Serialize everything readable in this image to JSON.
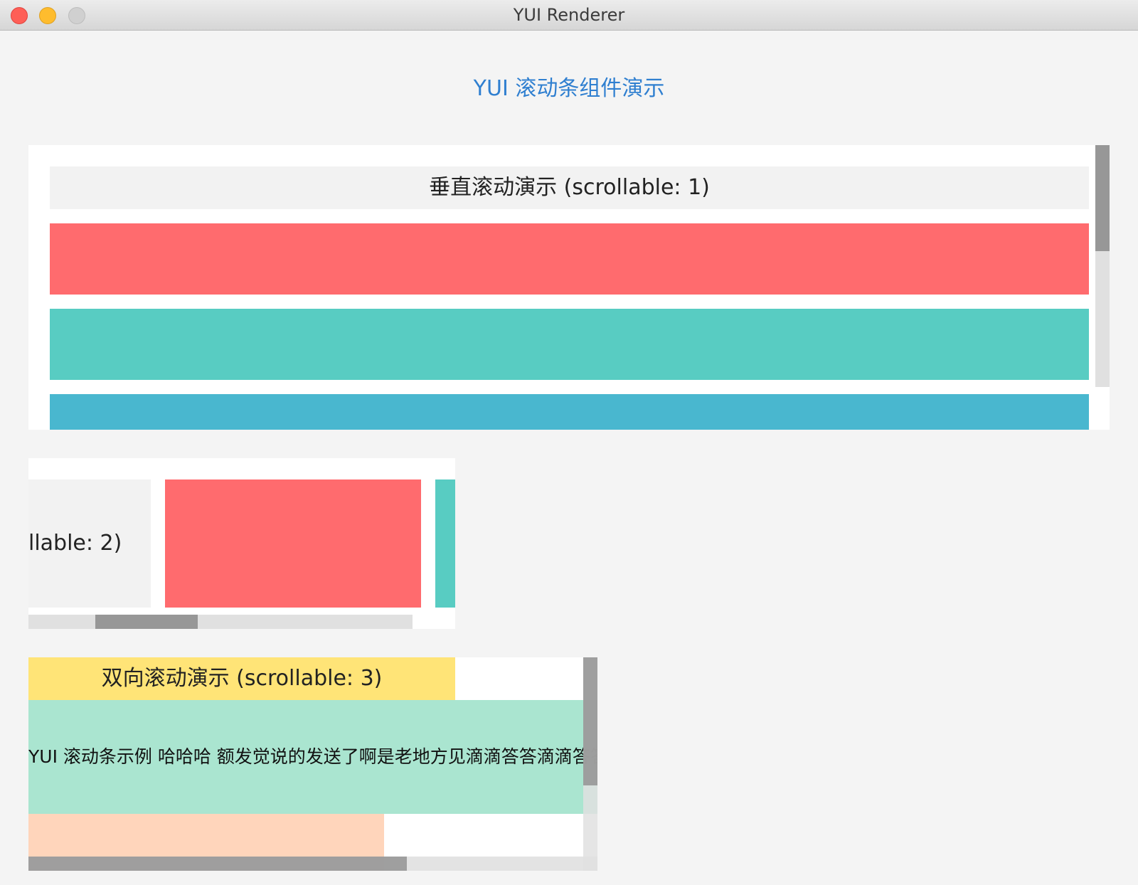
{
  "window": {
    "title": "YUI Renderer",
    "controls": [
      "close",
      "minimize",
      "zoom"
    ]
  },
  "page": {
    "heading": "YUI 滚动条组件演示"
  },
  "vertical_demo": {
    "title": "垂直滚动演示 (scrollable: 1)",
    "blocks": [
      {
        "color": "#ff6b6e"
      },
      {
        "color": "#58ccc2"
      },
      {
        "color": "#49b7cf"
      }
    ],
    "scroll_position": 0
  },
  "horizontal_demo": {
    "title_fragment": "llable: 2)",
    "blocks": [
      {
        "color": "#ff6b6e"
      },
      {
        "color": "#58ccc2"
      }
    ]
  },
  "bidirectional_demo": {
    "title": "双向滚动演示 (scrollable: 3)",
    "text": "YUI 滚动条示例 哈哈哈   额发觉说的发送了啊是老地方见滴滴答答滴滴答答滴滴答答",
    "colors": {
      "title_bg": "#ffe477",
      "text_bg": "#aae5d0",
      "bottom_bg": "#ffd5bb"
    }
  }
}
